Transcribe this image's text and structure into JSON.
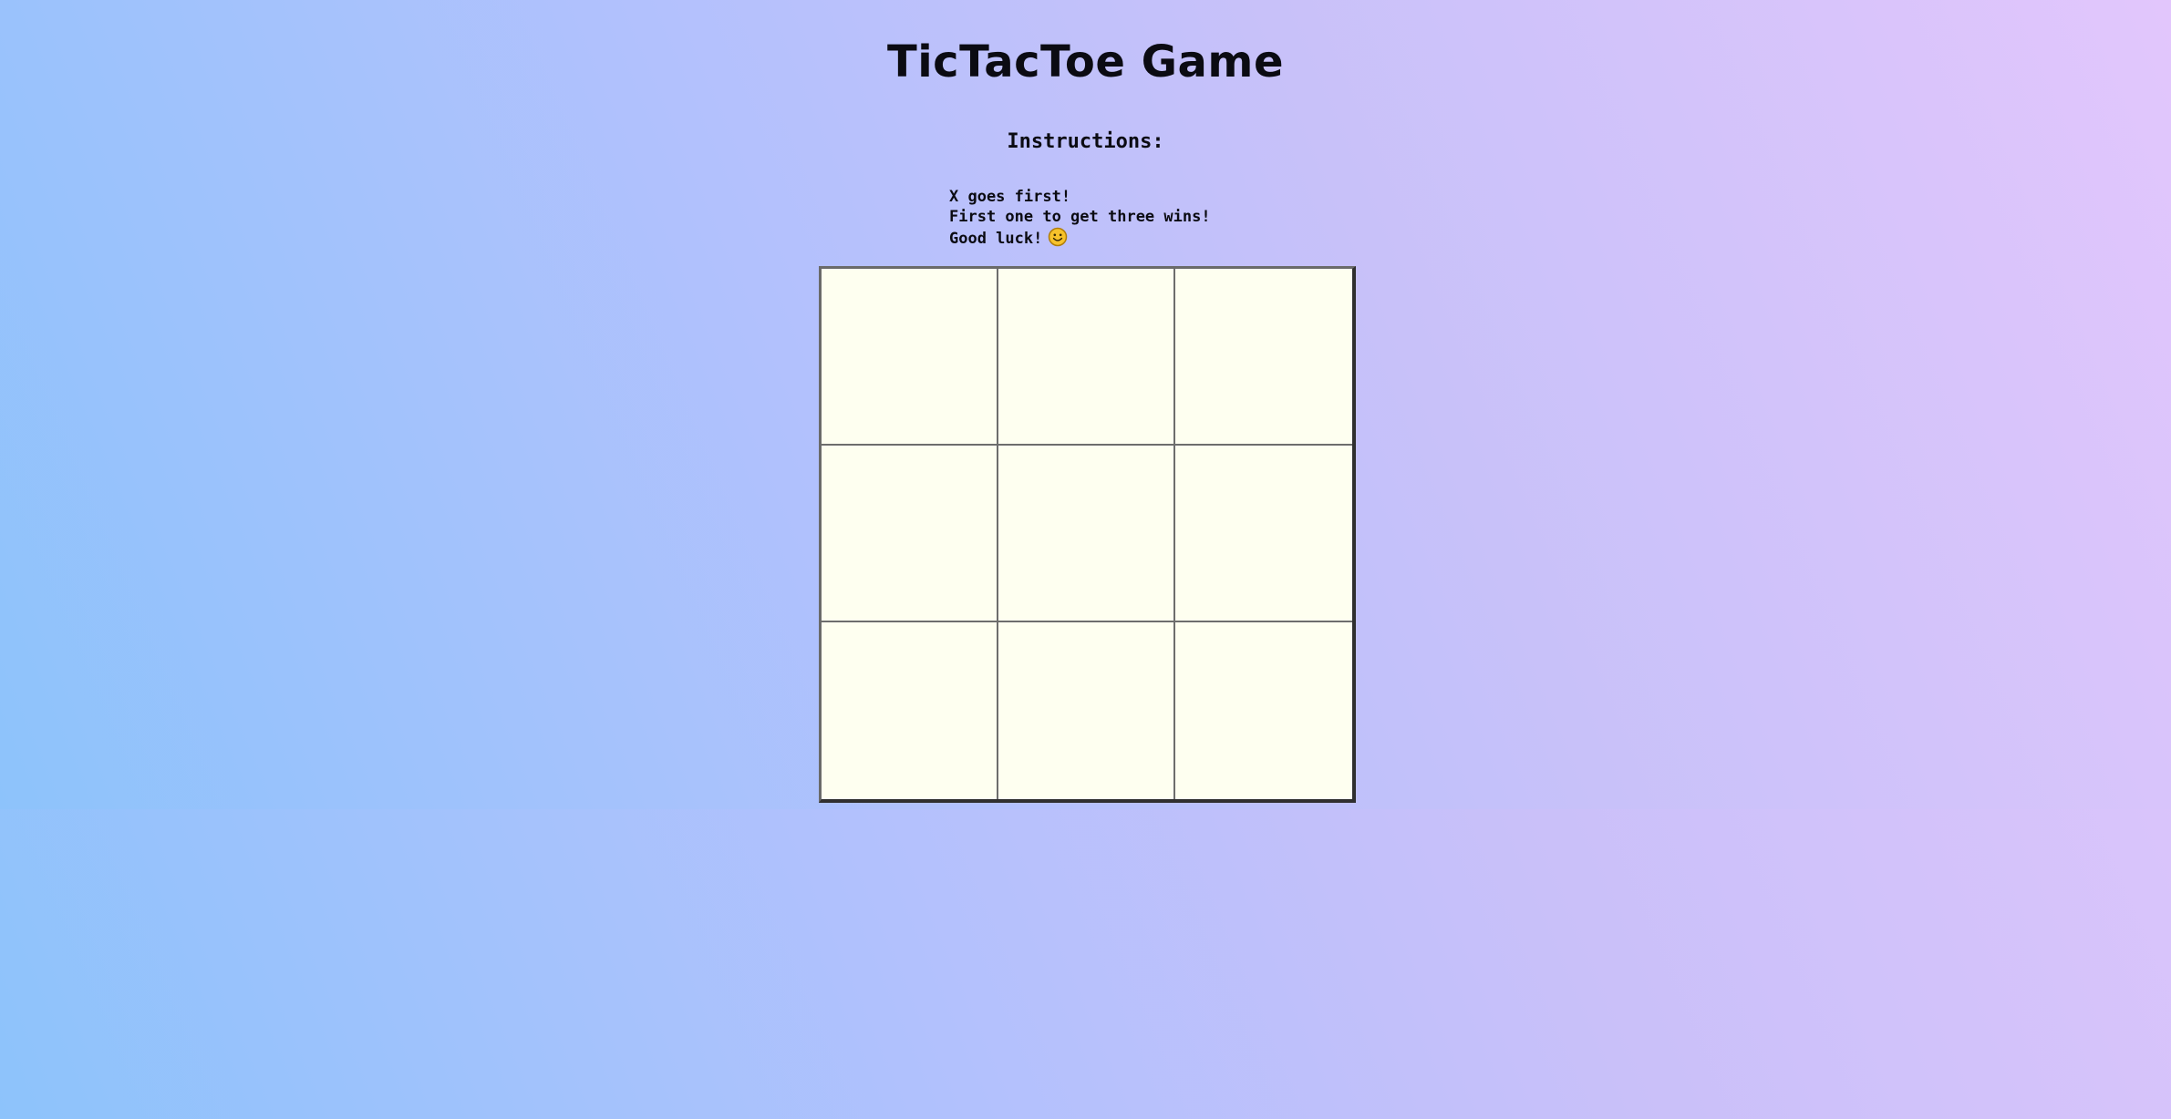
{
  "title": "TicTacToe Game",
  "instructions": {
    "heading": "Instructions:",
    "lines": [
      "X goes first!",
      "First one to get three wins!",
      "Good luck!"
    ],
    "emoji_icon": "smiling-face-icon"
  },
  "board": {
    "rows": 3,
    "cols": 3,
    "cells": [
      "",
      "",
      "",
      "",
      "",
      "",
      "",
      "",
      ""
    ]
  },
  "colors": {
    "board_background": "#fefff0",
    "grid_line": "#6d6d6d",
    "gradient_left": "#8dc3fb",
    "gradient_right": "#e2c6fc"
  }
}
